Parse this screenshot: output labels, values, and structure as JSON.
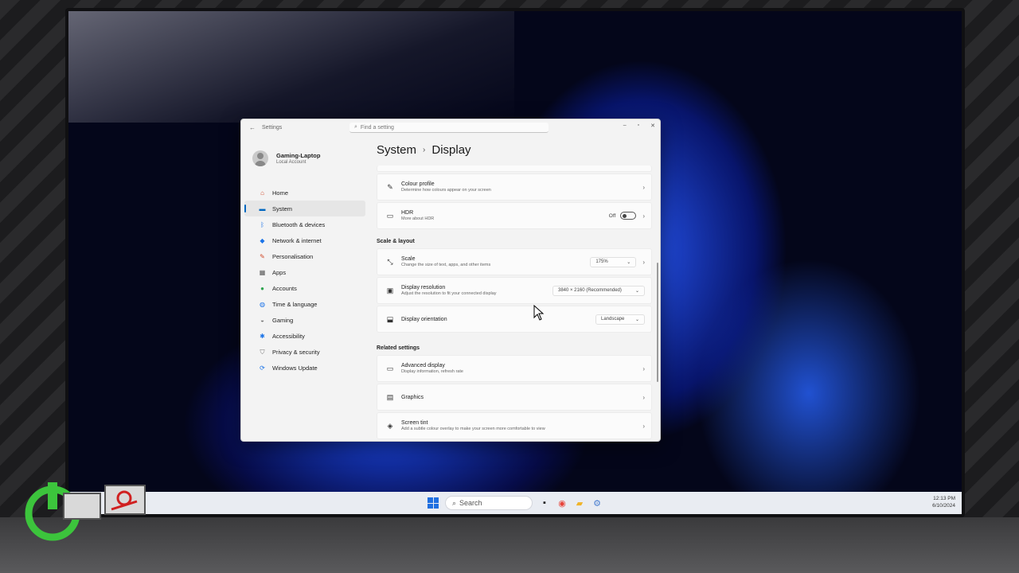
{
  "window": {
    "app_title": "Settings",
    "search_placeholder": "Find a setting",
    "controls": {
      "minimize": "–",
      "maximize": "▫",
      "close": "✕"
    }
  },
  "profile": {
    "name": "Gaming-Laptop",
    "account_type": "Local Account"
  },
  "nav": [
    {
      "label": "Home",
      "icon": "home-icon",
      "color": "#d04a2a"
    },
    {
      "label": "System",
      "icon": "monitor-icon",
      "color": "#0067c0",
      "active": true
    },
    {
      "label": "Bluetooth & devices",
      "icon": "bluetooth-icon",
      "color": "#1a73e8"
    },
    {
      "label": "Network & internet",
      "icon": "wifi-icon",
      "color": "#1a73e8"
    },
    {
      "label": "Personalisation",
      "icon": "brush-icon",
      "color": "#d04a2a"
    },
    {
      "label": "Apps",
      "icon": "apps-icon",
      "color": "#555555"
    },
    {
      "label": "Accounts",
      "icon": "account-icon",
      "color": "#2da44e"
    },
    {
      "label": "Time & language",
      "icon": "globe-icon",
      "color": "#1a73e8"
    },
    {
      "label": "Gaming",
      "icon": "gamepad-icon",
      "color": "#777777"
    },
    {
      "label": "Accessibility",
      "icon": "accessibility-icon",
      "color": "#1a73e8"
    },
    {
      "label": "Privacy & security",
      "icon": "shield-icon",
      "color": "#777777"
    },
    {
      "label": "Windows Update",
      "icon": "update-icon",
      "color": "#1a73e8"
    }
  ],
  "breadcrumb": {
    "parent": "System",
    "current": "Display"
  },
  "cards_top": [
    {
      "title": "Colour profile",
      "desc": "Determine how colours appear on your screen",
      "icon": "pen-icon"
    },
    {
      "title": "HDR",
      "desc": "More about HDR",
      "icon": "hdr-icon",
      "toggle_label": "Off"
    }
  ],
  "scale_layout": {
    "label": "Scale & layout",
    "scale": {
      "title": "Scale",
      "desc": "Change the size of text, apps, and other items",
      "value": "175%"
    },
    "resolution": {
      "title": "Display resolution",
      "desc": "Adjust the resolution to fit your connected display",
      "value": "3840 × 2160 (Recommended)"
    },
    "orientation": {
      "title": "Display orientation",
      "value": "Landscape"
    }
  },
  "related": {
    "label": "Related settings",
    "advanced": {
      "title": "Advanced display",
      "desc": "Display information, refresh rate"
    },
    "graphics": {
      "title": "Graphics"
    },
    "tint": {
      "title": "Screen tint",
      "desc": "Add a subtle colour overlay to make your screen more comfortable to view"
    }
  },
  "taskbar": {
    "search_label": "Search",
    "time": "12:13 PM",
    "date": "6/10/2024"
  },
  "accent": "#0067c0"
}
